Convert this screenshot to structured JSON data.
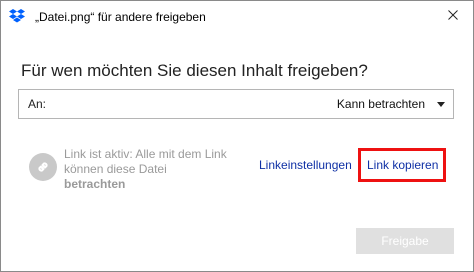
{
  "window": {
    "title": "„Datei.png“ für andere freigeben",
    "close_icon": "close-icon",
    "app_icon": "dropbox-icon"
  },
  "main": {
    "heading": "Für wen möchten Sie diesen Inhalt freigeben?",
    "recipient_label": "An:",
    "permission": {
      "selected": "Kann betrachten",
      "icon": "chevron-down-icon"
    }
  },
  "link": {
    "icon": "link-icon",
    "status_text": "Link ist aktiv: Alle mit dem Link können diese Datei",
    "status_bold": "betrachten",
    "settings_label": "Linkeinstellungen",
    "copy_label": "Link kopieren",
    "highlight_color": "#ee1111"
  },
  "footer": {
    "share_label": "Freigabe",
    "share_enabled": false
  }
}
